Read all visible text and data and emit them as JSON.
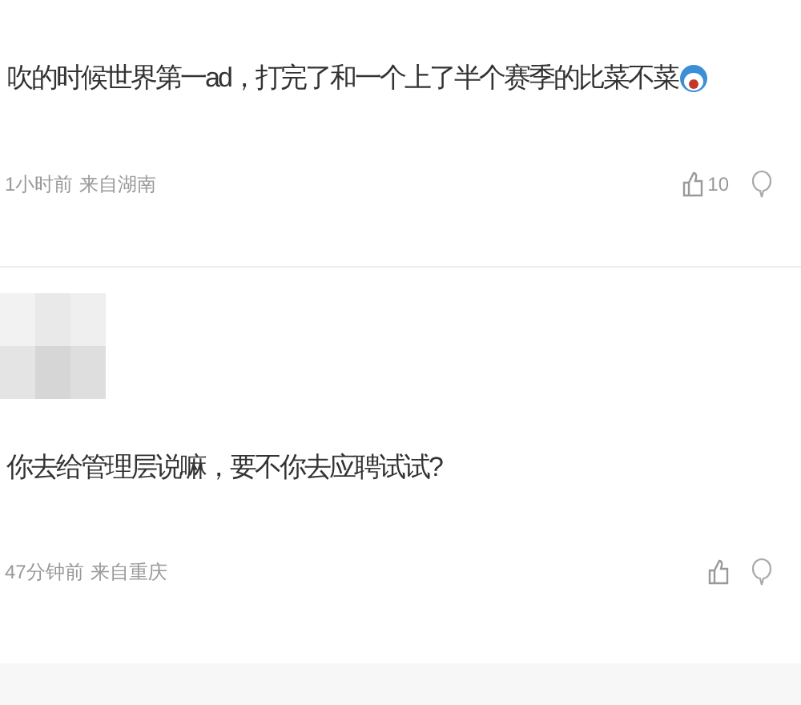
{
  "comments": [
    {
      "avatar": false,
      "text": "吹的时候世界第一ad，打完了和一个上了半个赛季的比菜不菜",
      "emoji": true,
      "time": "1小时前",
      "location": "来自湖南",
      "likes": "10"
    },
    {
      "avatar": true,
      "text": "你去给管理层说嘛，要不你去应聘试试?",
      "emoji": false,
      "time": "47分钟前",
      "location": "来自重庆"
    }
  ]
}
